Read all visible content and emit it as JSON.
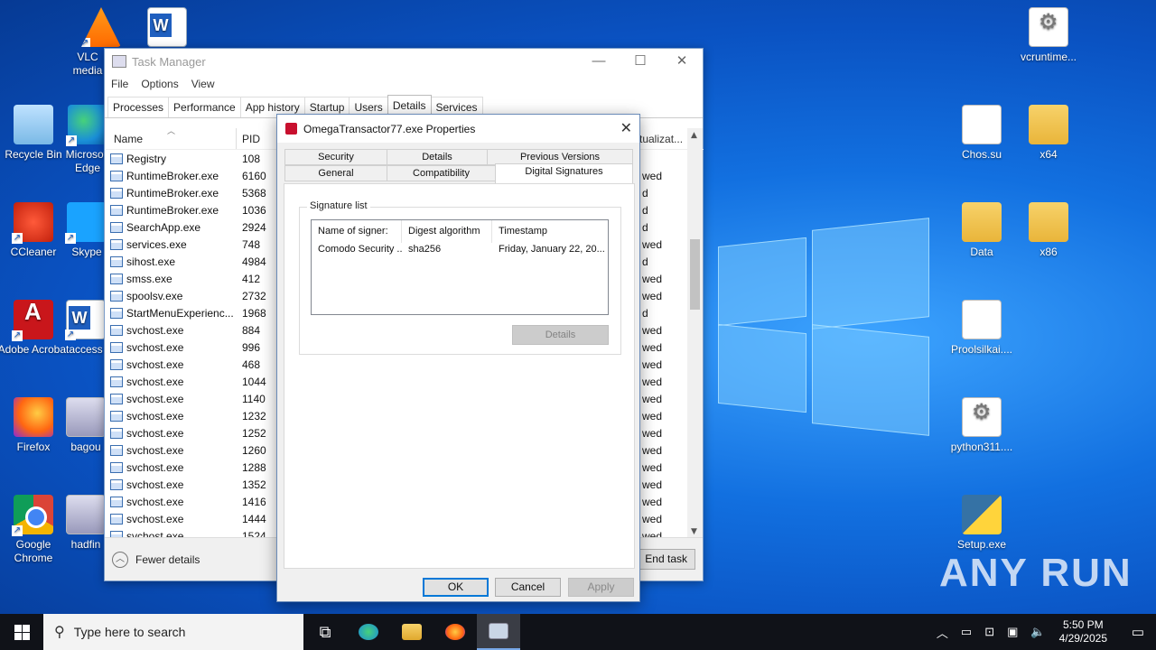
{
  "desktop": {
    "icons": [
      {
        "id": "vlc",
        "label": "VLC media player",
        "icon": "vlc-icon"
      },
      {
        "id": "word1",
        "label": "",
        "icon": "word-doc-icon"
      },
      {
        "id": "recycle",
        "label": "Recycle Bin",
        "icon": "recycle-bin-icon"
      },
      {
        "id": "edge",
        "label": "Microsoft Edge",
        "icon": "edge-icon"
      },
      {
        "id": "ccleaner",
        "label": "CCleaner",
        "icon": "ccleaner-icon"
      },
      {
        "id": "skype",
        "label": "Skype",
        "icon": "skype-icon"
      },
      {
        "id": "acrobat",
        "label": "Adobe Acrobat",
        "icon": "acrobat-icon"
      },
      {
        "id": "access",
        "label": "access",
        "icon": "word-doc-icon"
      },
      {
        "id": "firefox",
        "label": "Firefox",
        "icon": "firefox-icon"
      },
      {
        "id": "bagou",
        "label": "bagou",
        "icon": "image-file-icon"
      },
      {
        "id": "chrome",
        "label": "Google Chrome",
        "icon": "chrome-icon"
      },
      {
        "id": "hadfin",
        "label": "hadfin",
        "icon": "image-file-icon"
      },
      {
        "id": "vcruntime",
        "label": "vcruntime...",
        "icon": "settings-file-icon"
      },
      {
        "id": "chos",
        "label": "Chos.su",
        "icon": "blank-file-icon"
      },
      {
        "id": "x64",
        "label": "x64",
        "icon": "folder-icon"
      },
      {
        "id": "data",
        "label": "Data",
        "icon": "folder-icon"
      },
      {
        "id": "x86",
        "label": "x86",
        "icon": "folder-icon"
      },
      {
        "id": "proolsilkai",
        "label": "Proolsilkai....",
        "icon": "blank-file-icon"
      },
      {
        "id": "python311",
        "label": "python311....",
        "icon": "settings-file-icon"
      },
      {
        "id": "setup",
        "label": "Setup.exe",
        "icon": "python-setup-icon"
      }
    ],
    "watermark": "ANY RUN"
  },
  "task_manager": {
    "title": "Task Manager",
    "window_buttons": {
      "minimize": "—",
      "maximize": "☐",
      "close": "✕"
    },
    "menu": [
      "File",
      "Options",
      "View"
    ],
    "tabs": [
      "Processes",
      "Performance",
      "App history",
      "Startup",
      "Users",
      "Details",
      "Services"
    ],
    "active_tab": "Details",
    "columns": {
      "name": "Name",
      "pid": "PID",
      "virtualization": "tualizat..."
    },
    "rows": [
      {
        "name": "Registry",
        "pid": "108",
        "tail": ""
      },
      {
        "name": "RuntimeBroker.exe",
        "pid": "6160",
        "tail": "wed"
      },
      {
        "name": "RuntimeBroker.exe",
        "pid": "5368",
        "tail": "d"
      },
      {
        "name": "RuntimeBroker.exe",
        "pid": "1036",
        "tail": "d"
      },
      {
        "name": "SearchApp.exe",
        "pid": "2924",
        "tail": "d"
      },
      {
        "name": "services.exe",
        "pid": "748",
        "tail": "wed"
      },
      {
        "name": "sihost.exe",
        "pid": "4984",
        "tail": "d"
      },
      {
        "name": "smss.exe",
        "pid": "412",
        "tail": "wed"
      },
      {
        "name": "spoolsv.exe",
        "pid": "2732",
        "tail": "wed"
      },
      {
        "name": "StartMenuExperienc...",
        "pid": "1968",
        "tail": "d"
      },
      {
        "name": "svchost.exe",
        "pid": "884",
        "tail": "wed"
      },
      {
        "name": "svchost.exe",
        "pid": "996",
        "tail": "wed"
      },
      {
        "name": "svchost.exe",
        "pid": "468",
        "tail": "wed"
      },
      {
        "name": "svchost.exe",
        "pid": "1044",
        "tail": "wed"
      },
      {
        "name": "svchost.exe",
        "pid": "1140",
        "tail": "wed"
      },
      {
        "name": "svchost.exe",
        "pid": "1232",
        "tail": "wed"
      },
      {
        "name": "svchost.exe",
        "pid": "1252",
        "tail": "wed"
      },
      {
        "name": "svchost.exe",
        "pid": "1260",
        "tail": "wed"
      },
      {
        "name": "svchost.exe",
        "pid": "1288",
        "tail": "wed"
      },
      {
        "name": "svchost.exe",
        "pid": "1352",
        "tail": "wed"
      },
      {
        "name": "svchost.exe",
        "pid": "1416",
        "tail": "wed"
      },
      {
        "name": "svchost.exe",
        "pid": "1444",
        "tail": "wed"
      },
      {
        "name": "svchost.exe",
        "pid": "1524",
        "tail": "wed"
      }
    ],
    "fewer_details": "Fewer details",
    "end_task": "End task"
  },
  "properties_dialog": {
    "title": "OmegaTransactor77.exe Properties",
    "close": "✕",
    "tabs": {
      "security": "Security",
      "details": "Details",
      "previous_versions": "Previous Versions",
      "general": "General",
      "compatibility": "Compatibility",
      "digital_signatures": "Digital Signatures"
    },
    "signature_list_label": "Signature list",
    "signature_columns": [
      "Name of signer:",
      "Digest algorithm",
      "Timestamp"
    ],
    "signatures": [
      {
        "signer": "Comodo Security ...",
        "algorithm": "sha256",
        "timestamp": "Friday, January 22, 20..."
      }
    ],
    "details_button": "Details",
    "ok": "OK",
    "cancel": "Cancel",
    "apply": "Apply"
  },
  "taskbar": {
    "search_placeholder": "Type here to search",
    "time": "5:50 PM",
    "date": "4/29/2025"
  }
}
